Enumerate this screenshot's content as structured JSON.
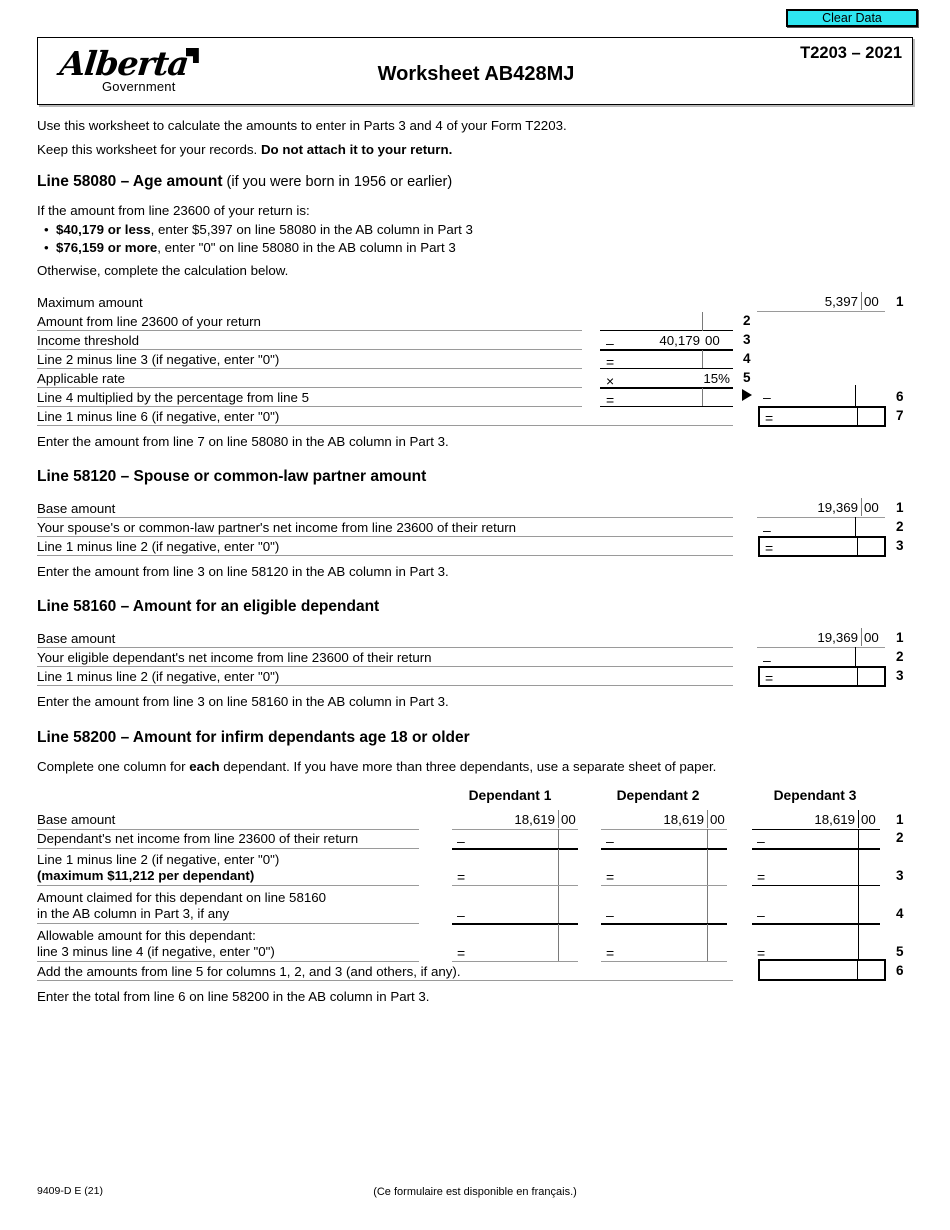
{
  "toolbar": {
    "clear_data_label": "Clear Data"
  },
  "header": {
    "logo_word": "Alberta",
    "logo_sub": "Government",
    "title": "Worksheet AB428MJ",
    "form_year": "T2203 – 2021"
  },
  "intro": {
    "line1": "Use this worksheet to calculate the amounts to enter in Parts 3 and 4 of your Form T2203.",
    "line2_plain": "Keep this worksheet for your records. ",
    "line2_bold": "Do not attach it to your return."
  },
  "sections": [
    {
      "heading_bold": "Line 58080 – Age amount",
      "heading_normal": " (if you were born in 1956 or earlier)",
      "intro_line": "If the amount from line 23600 of your return is:",
      "bullets": [
        {
          "bold": "$40,179 or less",
          "rest": ", enter $5,397 on line 58080 in the AB column in Part 3"
        },
        {
          "bold": "$76,159 or more",
          "rest": ", enter \"0\" on line 58080 in the AB column in Part 3"
        }
      ],
      "otherwise": "Otherwise, complete the calculation below.",
      "rows": [
        {
          "label": "Maximum amount",
          "num": "1",
          "value": "5,397",
          "cents": "00",
          "op": ""
        },
        {
          "label": "Amount from line 23600 of your return",
          "num": "2",
          "value": "",
          "cents": "",
          "op": ""
        },
        {
          "label": "Income threshold",
          "num": "3",
          "value": "40,179",
          "cents": "00",
          "op": "–"
        },
        {
          "label": "Line 2 minus line 3 (if negative, enter \"0\")",
          "num": "4",
          "value": "",
          "cents": "",
          "op": "="
        },
        {
          "label": "Applicable rate",
          "num": "5",
          "value": "15%",
          "cents": "",
          "op": "×"
        },
        {
          "label": "Line 4 multiplied by the percentage from line 5",
          "num": "6",
          "value": "",
          "cents": "",
          "op": "="
        },
        {
          "label": "Line 1 minus line 6 (if negative, enter \"0\")",
          "num": "7",
          "value": "",
          "cents": "",
          "op": "="
        }
      ],
      "closing": "Enter the amount from line 7 on line 58080 in the AB column in Part 3."
    },
    {
      "heading_bold": "Line 58120 – Spouse or common-law partner amount",
      "rows": [
        {
          "label": "Base amount",
          "num": "1",
          "value": "19,369",
          "cents": "00",
          "op": ""
        },
        {
          "label": "Your spouse's or common-law partner's net income from line 23600 of their return",
          "num": "2",
          "value": "",
          "cents": "",
          "op": "–"
        },
        {
          "label": "Line 1 minus line 2 (if negative, enter \"0\")",
          "num": "3",
          "value": "",
          "cents": "",
          "op": "="
        }
      ],
      "closing": "Enter the amount from line 3 on line 58120 in the AB column in Part 3."
    },
    {
      "heading_bold": "Line 58160 – Amount for an eligible dependant",
      "rows": [
        {
          "label": "Base amount",
          "num": "1",
          "value": "19,369",
          "cents": "00",
          "op": ""
        },
        {
          "label": "Your eligible dependant's net income from line 23600 of their return",
          "num": "2",
          "value": "",
          "cents": "",
          "op": "–"
        },
        {
          "label": "Line 1 minus line 2 (if negative, enter \"0\")",
          "num": "3",
          "value": "",
          "cents": "",
          "op": "="
        }
      ],
      "closing": "Enter the amount from line 3 on line 58160 in the AB column in Part 3."
    },
    {
      "heading_bold": "Line 58200 – Amount for infirm dependants age 18 or older",
      "instruction_pre": "Complete one column for ",
      "instruction_bold": "each",
      "instruction_post": " dependant. If you have more than three dependants, use a separate sheet of paper.",
      "column_headers": [
        "Dependant 1",
        "Dependant 2",
        "Dependant 3"
      ],
      "rows": [
        {
          "label_l1": "Base amount",
          "label_l2": "",
          "num": "1",
          "op": "",
          "values": [
            "18,619",
            "18,619",
            "18,619"
          ],
          "cents": [
            "00",
            "00",
            "00"
          ]
        },
        {
          "label_l1": "Dependant's net income from line 23600 of their return",
          "label_l2": "",
          "num": "2",
          "op": "–",
          "values": [
            "",
            "",
            ""
          ],
          "cents": [
            "",
            "",
            ""
          ]
        },
        {
          "label_l1": "Line 1 minus line 2 (if negative, enter \"0\")",
          "label_l2": "(maximum $11,212 per dependant)",
          "label_l2_bold": true,
          "num": "3",
          "op": "=",
          "values": [
            "",
            "",
            ""
          ],
          "cents": [
            "",
            "",
            ""
          ]
        },
        {
          "label_l1": "Amount claimed for this dependant on line 58160",
          "label_l2": "in the AB column in Part 3, if any",
          "num": "4",
          "op": "–",
          "values": [
            "",
            "",
            ""
          ],
          "cents": [
            "",
            "",
            ""
          ]
        },
        {
          "label_l1": "Allowable amount for this dependant:",
          "label_l2": "line 3 minus line 4 (if negative, enter \"0\")",
          "num": "5",
          "op": "=",
          "values": [
            "",
            "",
            ""
          ],
          "cents": [
            "",
            "",
            ""
          ]
        },
        {
          "label_l1": "Add the amounts from line 5 for columns 1, 2, and 3 (and others, if any).",
          "label_l2": "",
          "num": "6",
          "op": "",
          "values": [
            "",
            "",
            ""
          ],
          "cents": [
            "",
            "",
            ""
          ]
        }
      ],
      "closing": "Enter the total from line 6 on line 58200 in the AB column in Part 3."
    }
  ],
  "footer": {
    "form_code": "9409-D E (21)",
    "french_note": "(Ce formulaire est disponible en français.)"
  }
}
